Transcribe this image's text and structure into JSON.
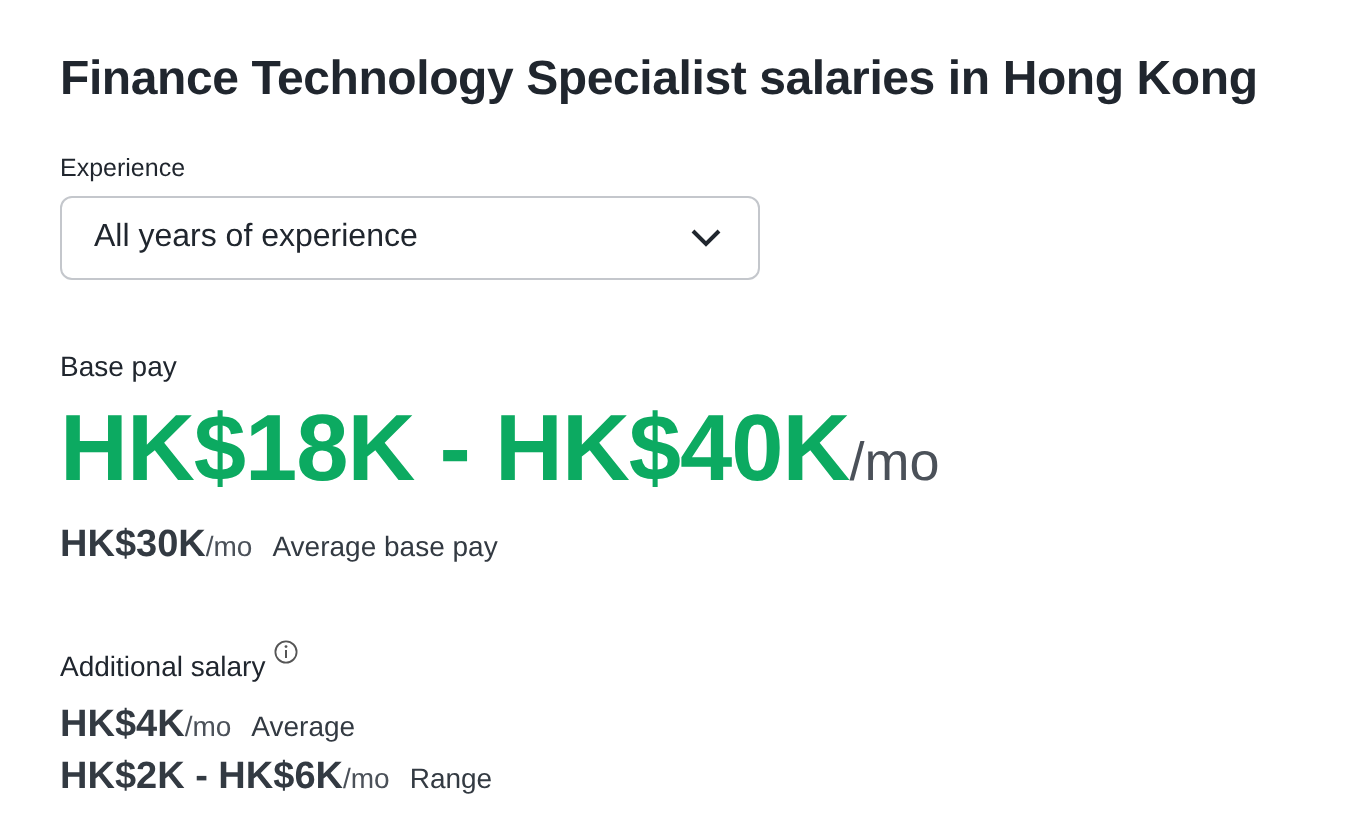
{
  "title": "Finance Technology Specialist salaries in Hong Kong",
  "experience": {
    "label": "Experience",
    "value": "All years of experience"
  },
  "base_pay": {
    "label": "Base pay",
    "range": "HK$18K - HK$40K",
    "range_unit": "/mo",
    "average": "HK$30K",
    "average_unit": "/mo",
    "average_label": "Average base pay"
  },
  "additional_salary": {
    "label": "Additional salary",
    "rows": [
      {
        "amount": "HK$4K",
        "unit": "/mo",
        "label": "Average"
      },
      {
        "amount": "HK$2K - HK$6K",
        "unit": "/mo",
        "label": "Range"
      }
    ]
  }
}
